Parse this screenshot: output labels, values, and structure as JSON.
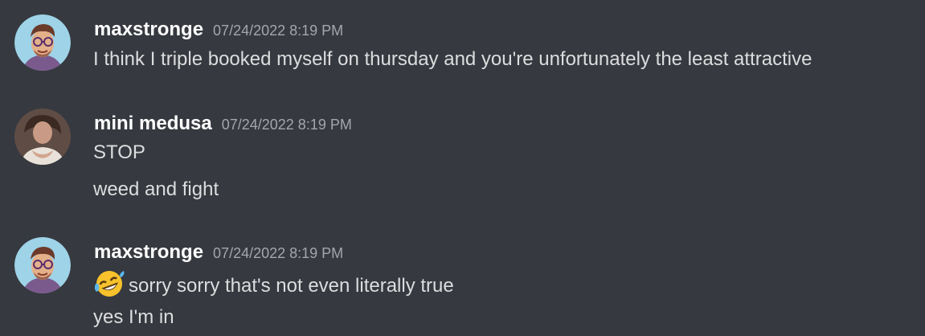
{
  "messages": [
    {
      "username": "maxstronge",
      "timestamp": "07/24/2022 8:19 PM",
      "lines": [
        "I think I triple booked myself on thursday and you're unfortunately the least attractive"
      ]
    },
    {
      "username": "mini medusa",
      "timestamp": "07/24/2022 8:19 PM",
      "lines": [
        "STOP",
        "weed and fight"
      ]
    },
    {
      "username": "maxstronge",
      "timestamp": "07/24/2022 8:19 PM",
      "lines": [
        "sorry sorry that's not even literally true",
        "yes I'm in"
      ],
      "emoji": "rolling-on-floor-laughing-emoji"
    }
  ],
  "colors": {
    "background": "#36393f",
    "username": "#ffffff",
    "timestamp": "#a3a6aa",
    "message_text": "#dcddde"
  }
}
